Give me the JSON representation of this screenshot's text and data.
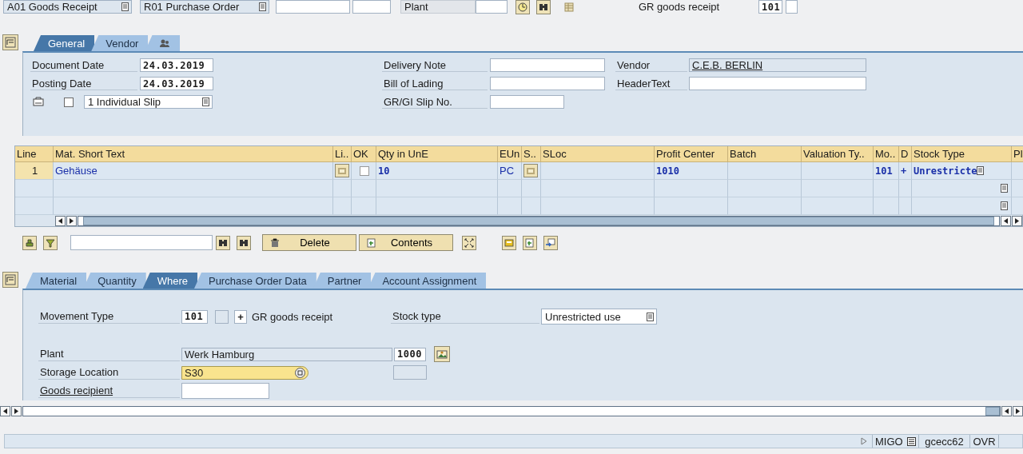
{
  "top_bar": {
    "action": "A01 Goods Receipt",
    "reference": "R01 Purchase Order",
    "plant_label": "Plant",
    "movement_label": "GR goods receipt",
    "movement_type": "101"
  },
  "header": {
    "tabs": [
      {
        "kind": "text",
        "label": "General",
        "selected": true
      },
      {
        "kind": "text",
        "label": "Vendor",
        "selected": false
      },
      {
        "kind": "icon",
        "selected": false
      }
    ],
    "document_date": {
      "label": "Document Date",
      "value": "24.03.2019"
    },
    "posting_date": {
      "label": "Posting Date",
      "value": "24.03.2019"
    },
    "print_checked": false,
    "slip": "1 Individual Slip",
    "delivery_note": {
      "label": "Delivery Note"
    },
    "bill_of_lading": {
      "label": "Bill of Lading"
    },
    "slip_number": {
      "label": "GR/GI Slip No."
    },
    "vendor": {
      "label": "Vendor",
      "value": "C.E.B. BERLIN"
    },
    "header_text": {
      "label": "HeaderText"
    }
  },
  "items": {
    "columns": [
      "Line",
      "Mat. Short Text",
      "Li..",
      "OK",
      "Qty in UnE",
      "EUn",
      "S..",
      "SLoc",
      "Profit Center",
      "Batch",
      "Valuation Ty..",
      "Mo..",
      "D",
      "Stock Type",
      "Pl"
    ],
    "rows": [
      {
        "kind": "item",
        "line": "1",
        "material": "Gehäuse",
        "ok": false,
        "qty": "10",
        "unit": "PC",
        "profit_center": "1010",
        "movement": "101",
        "sign": "+",
        "stock_type": "Unrestricte"
      },
      {
        "kind": "empty"
      },
      {
        "kind": "empty"
      }
    ]
  },
  "toolbar": {
    "delete": "Delete",
    "contents": "Contents"
  },
  "detail": {
    "tabs": [
      {
        "label": "Material",
        "selected": false
      },
      {
        "label": "Quantity",
        "selected": false
      },
      {
        "label": "Where",
        "selected": true
      },
      {
        "label": "Purchase Order Data",
        "selected": false
      },
      {
        "label": "Partner",
        "selected": false
      },
      {
        "label": "Account Assignment",
        "selected": false
      }
    ],
    "movement_type": {
      "label": "Movement Type",
      "value": "101",
      "sign": "+",
      "text": "GR goods receipt"
    },
    "stock_type": {
      "label": "Stock type",
      "value": "Unrestricted use"
    },
    "plant": {
      "label": "Plant",
      "name": "Werk Hamburg",
      "code": "1000"
    },
    "storage_location": {
      "label": "Storage Location",
      "value": "S30"
    },
    "goods_recipient": {
      "label": "Goods recipient"
    }
  },
  "status_bar": {
    "transaction": "MIGO",
    "server": "gcecc62",
    "mode": "OVR"
  }
}
